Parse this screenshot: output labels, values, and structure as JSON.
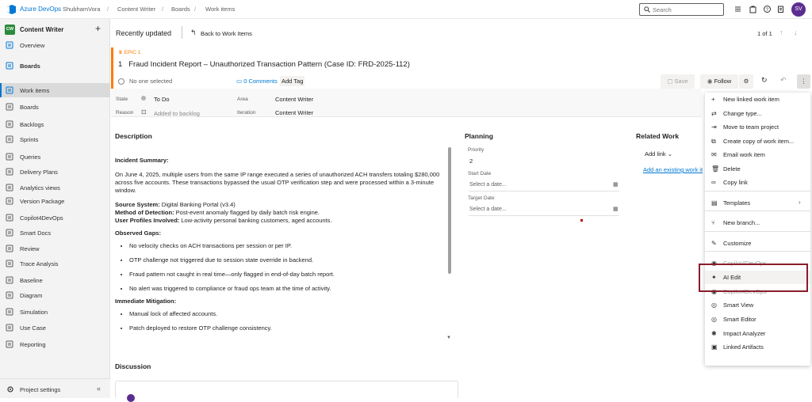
{
  "topbar": {
    "brand": "Azure DevOps",
    "org": "ShubhamVora",
    "crumbs": [
      "Content Writer",
      "Boards",
      "Work items"
    ],
    "search_placeholder": "Search",
    "avatar_initials": "SV"
  },
  "sidebar": {
    "project_badge": "CW",
    "project_name": "Content Writer",
    "add": "+",
    "items": [
      {
        "label": "Overview",
        "icon": "overview-icon"
      },
      {
        "label": "Boards",
        "icon": "boards-icon"
      },
      {
        "label": "Work items",
        "icon": "work-items-icon",
        "active": true
      },
      {
        "label": "Boards",
        "icon": "board-icon"
      },
      {
        "label": "Backlogs",
        "icon": "backlogs-icon"
      },
      {
        "label": "Sprints",
        "icon": "sprints-icon"
      },
      {
        "label": "Queries",
        "icon": "queries-icon"
      },
      {
        "label": "Delivery Plans",
        "icon": "delivery-plans-icon"
      },
      {
        "label": "Analytics views",
        "icon": "analytics-icon"
      },
      {
        "label": "Version Package",
        "icon": "version-package-icon"
      },
      {
        "label": "Copilot4DevOps",
        "icon": "copilot-icon"
      },
      {
        "label": "Smart Docs",
        "icon": "smart-docs-icon"
      },
      {
        "label": "Review",
        "icon": "review-icon"
      },
      {
        "label": "Trace Analysis",
        "icon": "trace-icon"
      },
      {
        "label": "Baseline",
        "icon": "baseline-icon"
      },
      {
        "label": "Diagram",
        "icon": "diagram-icon"
      },
      {
        "label": "Simulation",
        "icon": "simulation-icon"
      },
      {
        "label": "Use Case",
        "icon": "use-case-icon"
      },
      {
        "label": "Reporting",
        "icon": "reporting-icon"
      }
    ],
    "footer": "Project settings",
    "collapse": "«"
  },
  "header": {
    "recent": "Recently updated",
    "back": "Back to Work Items",
    "pager": "1 of 1"
  },
  "workitem": {
    "type_label": "EPIC 1",
    "id": "1",
    "title": "Fraud Incident Report – Unauthorized Transaction Pattern (Case ID: FRD-2025-112)",
    "assigned": "No one selected",
    "comments": "0 Comments",
    "add_tag": "Add Tag",
    "save": "Save",
    "follow": "Follow",
    "fields": {
      "state_label": "State",
      "state": "To Do",
      "reason_label": "Reason",
      "reason": "Added to backlog",
      "area_label": "Area",
      "area": "Content Writer",
      "iteration_label": "Iteration",
      "iteration": "Content Writer"
    }
  },
  "description": {
    "title": "Description",
    "summary_heading": "Incident Summary:",
    "summary": "On June 4, 2025, multiple users from the same IP range executed a series of unauthorized ACH transfers totaling $280,000 across five accounts. These transactions bypassed the usual OTP verification step and were processed within a 3-minute window.",
    "source_label": "Source System:",
    "source": " Digital Banking Portal (v3.4)",
    "method_label": "Method of Detection:",
    "method": " Post-event anomaly flagged by daily batch risk engine.",
    "profiles_label": "User Profiles Involved:",
    "profiles": " Low-activity personal banking customers, aged accounts.",
    "gaps_heading": "Observed Gaps:",
    "gaps": [
      "No velocity checks on ACH transactions per session or per IP.",
      "OTP challenge not triggered due to session state override in backend.",
      "Fraud pattern not caught in real time—only flagged in end-of-day batch report.",
      "No alert was triggered to compliance or fraud ops team at the time of activity."
    ],
    "mitigation_heading": "Immediate Mitigation:",
    "mitigation": [
      "Manual lock of affected accounts.",
      "Patch deployed to restore OTP challenge consistency."
    ]
  },
  "discussion": {
    "title": "Discussion"
  },
  "planning": {
    "title": "Planning",
    "priority_label": "Priority",
    "priority": "2",
    "start_label": "Start Date",
    "start_placeholder": "Select a date...",
    "target_label": "Target Date",
    "target_placeholder": "Select a date..."
  },
  "related": {
    "title": "Related Work",
    "add_link": "Add link",
    "existing": "Add an existing work it"
  },
  "menu": {
    "items": [
      {
        "label": "New linked work item",
        "icon": "new-linked-icon"
      },
      {
        "label": "Change type...",
        "icon": "change-type-icon"
      },
      {
        "label": "Move to team project",
        "icon": "move-icon"
      },
      {
        "label": "Create copy of work item...",
        "icon": "copy-work-item-icon"
      },
      {
        "label": "Email work item",
        "icon": "email-icon"
      },
      {
        "label": "Delete",
        "icon": "delete-icon"
      },
      {
        "label": "Copy link",
        "icon": "link-icon"
      },
      {
        "label": "Templates",
        "icon": "templates-icon"
      },
      {
        "label": "New branch...",
        "icon": "branch-icon"
      },
      {
        "label": "Customize",
        "icon": "customize-icon"
      },
      {
        "label": "Copilot4DevOps",
        "icon": "copilot-icon"
      },
      {
        "label": "AI Edit",
        "icon": "ai-edit-icon"
      },
      {
        "label": "Copilot4DevOps",
        "icon": "copilot-icon"
      },
      {
        "label": "Smart View",
        "icon": "smart-view-icon"
      },
      {
        "label": "Smart Editor",
        "icon": "smart-editor-icon"
      },
      {
        "label": "Impact Analyzer",
        "icon": "impact-icon"
      },
      {
        "label": "Linked Artifacts",
        "icon": "linked-artifacts-icon"
      }
    ]
  }
}
